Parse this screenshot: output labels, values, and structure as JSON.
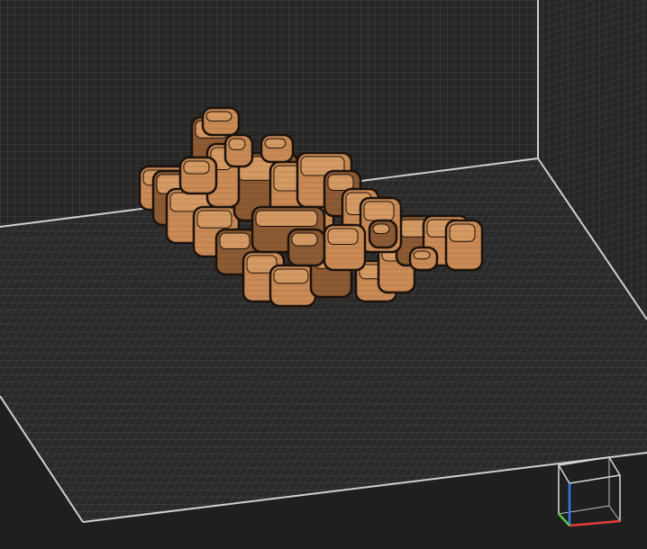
{
  "viewport": {
    "background_color": "#202020",
    "grid_color": "#4b4b4b",
    "grid_line_color": "#5a5a5a",
    "boundary_color": "#cfcfd6",
    "floor_color": "#2b2b2b",
    "wall_color": "#272727"
  },
  "model": {
    "name": "voxel-model",
    "face_color": "#c98a55",
    "top_color": "#d59a63",
    "edge_color": "#1b120c",
    "shadow_color": "#8c5a33"
  },
  "view_cube": {
    "axis_colors": {
      "x": "#e53b3b",
      "y": "#2f7be6",
      "z": "#53c83a"
    },
    "line_color": "#d8d8d8"
  }
}
